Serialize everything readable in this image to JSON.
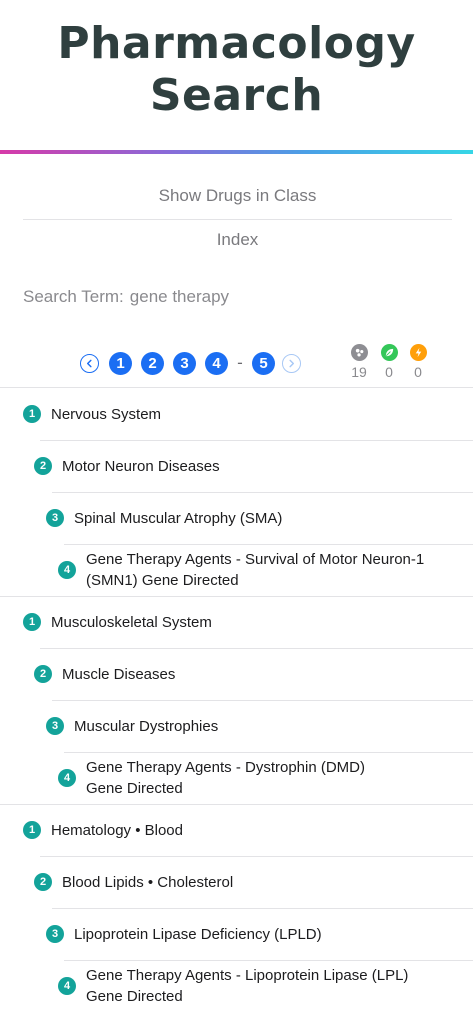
{
  "app": {
    "title_line1": "Pharmacology",
    "title_line2": "Search"
  },
  "menu": {
    "show_drugs": "Show Drugs in Class",
    "index": "Index"
  },
  "search": {
    "label": "Search Term:",
    "value": "gene therapy"
  },
  "pagination": {
    "prev_icon": "chevron-left-icon",
    "next_icon": "chevron-right-icon",
    "pages": [
      "1",
      "2",
      "3",
      "4"
    ],
    "separator": "-",
    "last_page": "5"
  },
  "counters": [
    {
      "icon": "molecule-icon",
      "color": "#8e8e93",
      "value": "19"
    },
    {
      "icon": "leaf-icon",
      "color": "#34c759",
      "value": "0"
    },
    {
      "icon": "bolt-icon",
      "color": "#ff9f0a",
      "value": "0"
    }
  ],
  "colors": {
    "accent": "#1b6ef3",
    "level_badge": "#13a39a",
    "title": "#2f3f3f"
  },
  "tree": [
    {
      "level": "1",
      "lines": [
        "Nervous System"
      ]
    },
    {
      "level": "2",
      "lines": [
        "Motor Neuron Diseases"
      ]
    },
    {
      "level": "3",
      "lines": [
        "Spinal Muscular Atrophy (SMA)"
      ]
    },
    {
      "level": "4",
      "lines": [
        "Gene Therapy Agents - Survival of Motor Neuron-1",
        "(SMN1) Gene Directed"
      ]
    },
    {
      "level": "1",
      "lines": [
        "Musculoskeletal System"
      ]
    },
    {
      "level": "2",
      "lines": [
        "Muscle Diseases"
      ]
    },
    {
      "level": "3",
      "lines": [
        "Muscular Dystrophies"
      ]
    },
    {
      "level": "4",
      "lines": [
        "Gene Therapy Agents - Dystrophin (DMD)",
        "Gene Directed"
      ]
    },
    {
      "level": "1",
      "lines": [
        "Hematology • Blood"
      ]
    },
    {
      "level": "2",
      "lines": [
        "Blood Lipids • Cholesterol"
      ]
    },
    {
      "level": "3",
      "lines": [
        "Lipoprotein Lipase Deficiency (LPLD)"
      ]
    },
    {
      "level": "4",
      "lines": [
        "Gene Therapy Agents - Lipoprotein Lipase (LPL)",
        "Gene Directed"
      ]
    }
  ]
}
